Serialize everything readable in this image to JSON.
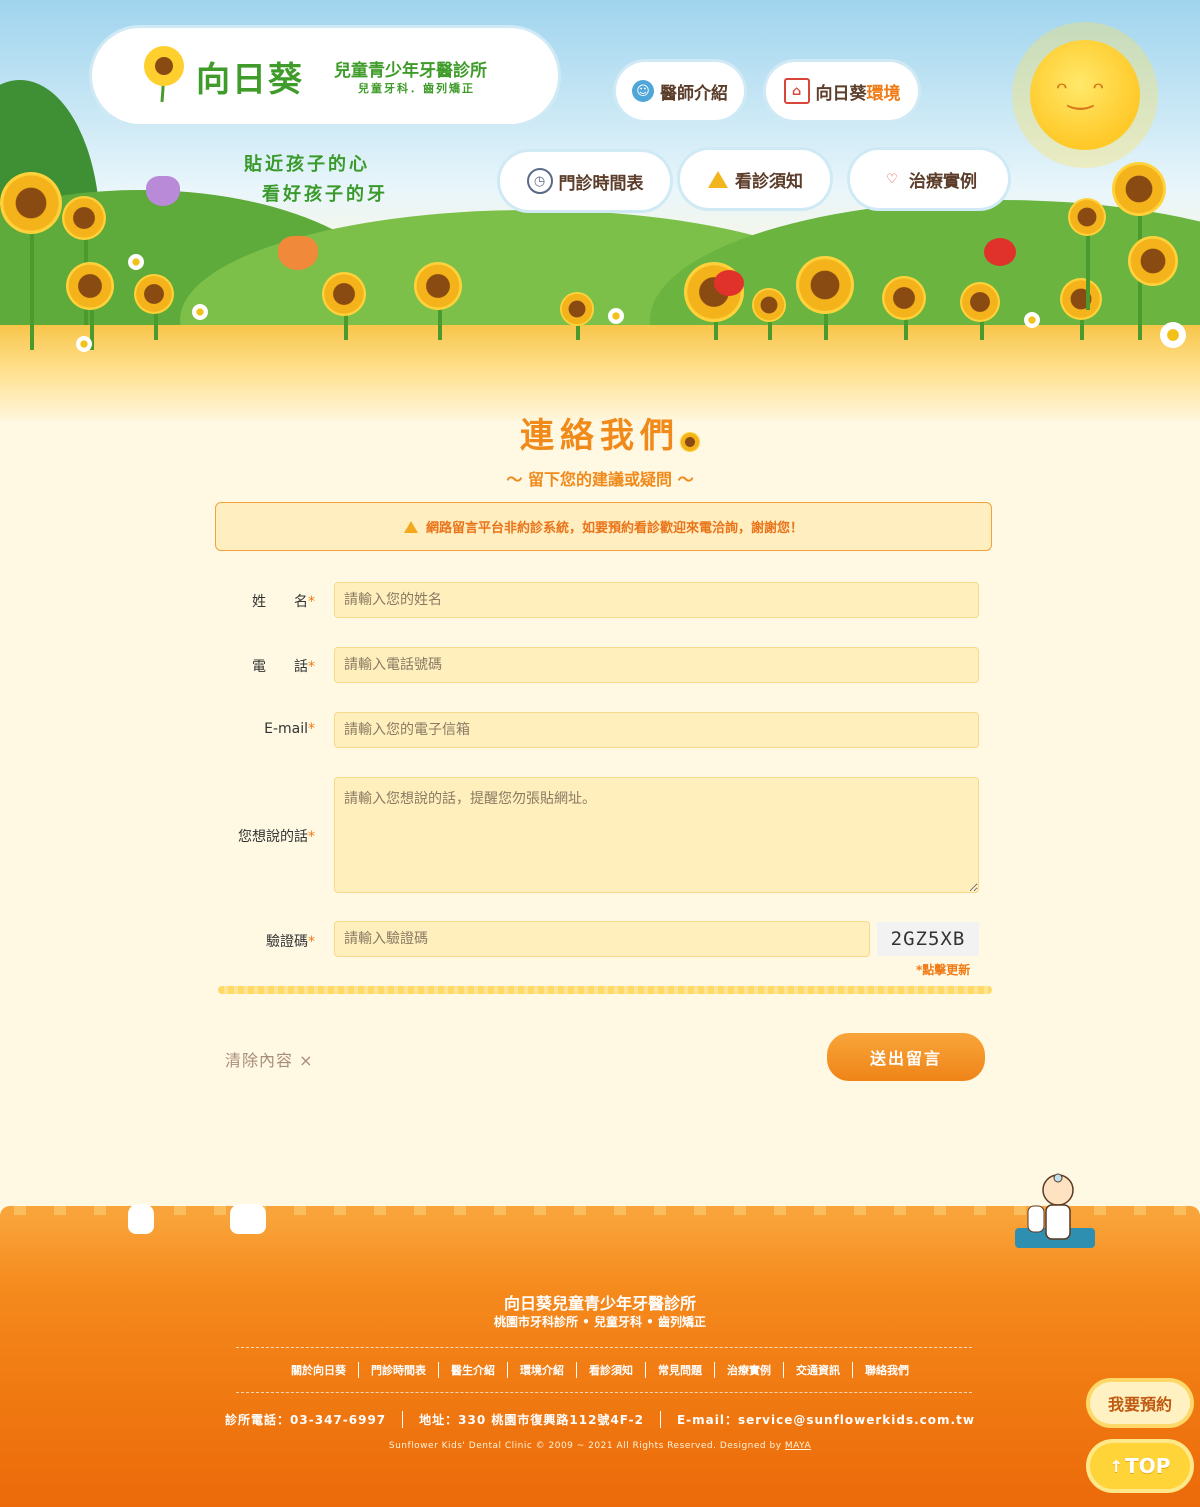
{
  "header": {
    "logo_name": "向日葵",
    "logo_subtitle": "兒童青少年牙醫診所",
    "logo_tagline": "兒童牙科．齒列矯正",
    "slogan_line1": "貼近孩子的心",
    "slogan_line2": "看好孩子的牙"
  },
  "nav": {
    "doctor": {
      "label": "醫師介紹"
    },
    "env": {
      "label_a": "向日葵",
      "label_b": "環境"
    },
    "schedule": {
      "label": "門診時間表"
    },
    "notes": {
      "label": "看診須知"
    },
    "cases": {
      "label": "治療實例"
    }
  },
  "main": {
    "title": "連絡我們",
    "subtitle": "～ 留下您的建議或疑問 ～",
    "notice": "網路留言平台非約診系統，如要預約看診歡迎來電洽詢，謝謝您！"
  },
  "form": {
    "name": {
      "label": "姓　　名",
      "placeholder": "請輸入您的姓名"
    },
    "phone": {
      "label": "電　　話",
      "placeholder": "請輸入電話號碼"
    },
    "email": {
      "label": "E-mail",
      "placeholder": "請輸入您的電子信箱"
    },
    "message": {
      "label": "您想說的話",
      "placeholder": "請輸入您想說的話，提醒您勿張貼網址。"
    },
    "captcha": {
      "label": "驗證碼",
      "placeholder": "請輸入驗證碼",
      "code": "2GZ5XB",
      "refresh": "*點擊更新"
    },
    "required_mark": "*",
    "clear_label": "清除內容 ×",
    "submit_label": "送出留言"
  },
  "footer": {
    "title": "向日葵兒童青少年牙醫診所",
    "subtitle": "桃園市牙科診所 • 兒童牙科 • 齒列矯正",
    "links": [
      "關於向日葵",
      "門診時間表",
      "醫生介紹",
      "環境介紹",
      "看診須知",
      "常見問題",
      "治療實例",
      "交通資訊",
      "聯絡我們"
    ],
    "phone": "診所電話：03-347-6997",
    "address": "地址：330 桃園市復興路112號4F-2",
    "email": "E-mail：service@sunflowerkids.com.tw",
    "copyright": "Sunflower Kids' Dental Clinic © 2009 ~ 2021 All Rights Reserved. Designed by",
    "designer": "MAYA"
  },
  "floating": {
    "reserve_label": "我要預約",
    "top_label": "TOP"
  },
  "colors": {
    "accent": "#f08a1a",
    "brand_green": "#3f9c2a",
    "input_bg": "#ffefbd",
    "footer": "#f07a12"
  },
  "icons": {
    "doctor": "doctor-avatar-icon",
    "env": "house-icon",
    "schedule": "clock-icon",
    "notes": "warning-icon",
    "cases": "tooth-icon"
  }
}
